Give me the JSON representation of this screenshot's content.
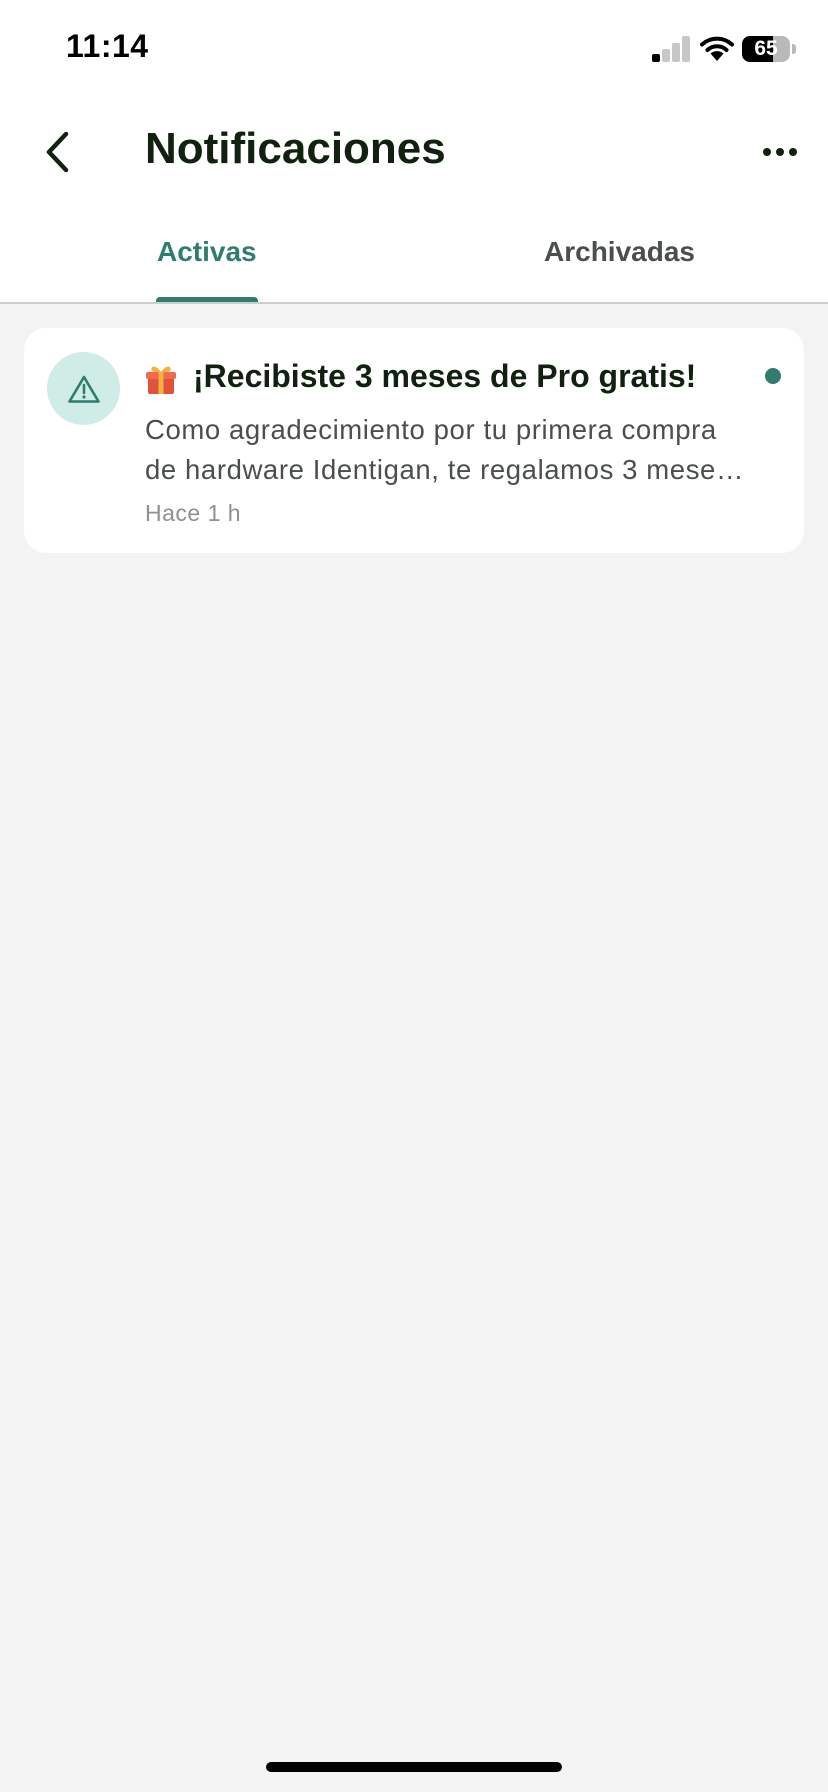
{
  "status_bar": {
    "time": "11:14",
    "battery_level": "65",
    "battery_fraction": 0.65,
    "signal_bars_active": 1,
    "icons": [
      "signal-icon",
      "wifi-icon",
      "battery-icon"
    ]
  },
  "header": {
    "back_icon": "chevron-left-icon",
    "title": "Notificaciones",
    "more_icon": "ellipsis-icon"
  },
  "tabs": [
    {
      "label": "Activas",
      "active": true
    },
    {
      "label": "Archivadas",
      "active": false
    }
  ],
  "notifications": [
    {
      "icon": "warning-triangle-icon",
      "emoji_icon": "gift-icon",
      "title": "¡Recibiste 3 meses de Pro gratis!",
      "body_line1": "Como agradecimiento por tu primera compra",
      "body_line2": "de hardware Identigan, te regalamos 3 mese…",
      "time": "Hace 1 h",
      "unread": true
    }
  ],
  "colors": {
    "accent": "#2e7d6e",
    "avatar_bg": "#cfece7",
    "page_bg": "#f3f3f3",
    "title_text": "#10220f",
    "body_text": "#4a4f4c",
    "muted_text": "#8d918f"
  }
}
